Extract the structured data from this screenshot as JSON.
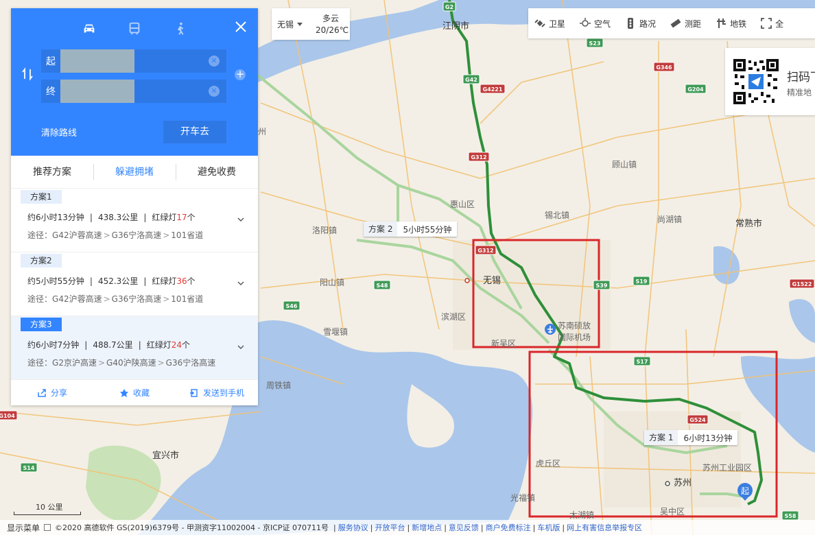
{
  "panel": {
    "modes": [
      {
        "name": "car-icon",
        "active": true
      },
      {
        "name": "bus-icon",
        "active": false
      },
      {
        "name": "walk-icon",
        "active": false
      }
    ],
    "start_label": "起",
    "end_label": "终",
    "clear_route": "清除路线",
    "go_button": "开车去",
    "tabs": [
      "推荐方案",
      "躲避拥堵",
      "避免收费"
    ],
    "active_tab": 1,
    "plans": [
      {
        "tag": "方案1",
        "time": "约6小时13分钟",
        "distance": "438.3公里",
        "lights_prefix": "红绿灯",
        "lights_count": "17",
        "lights_suffix": "个",
        "via_label": "途径：",
        "via": [
          "G42沪蓉高速",
          "G36宁洛高速",
          "101省道"
        ]
      },
      {
        "tag": "方案2",
        "time": "约5小时55分钟",
        "distance": "452.3公里",
        "lights_prefix": "红绿灯",
        "lights_count": "36",
        "lights_suffix": "个",
        "via_label": "途径：",
        "via": [
          "G42沪蓉高速",
          "G36宁洛高速",
          "101省道"
        ]
      },
      {
        "tag": "方案3",
        "time": "约6小时7分钟",
        "distance": "488.7公里",
        "lights_prefix": "红绿灯",
        "lights_count": "24",
        "lights_suffix": "个",
        "via_label": "途径：",
        "via": [
          "G2京沪高速",
          "G40沪陕高速",
          "G36宁洛高速"
        ]
      }
    ],
    "selected_plan": 2,
    "footer": {
      "share": "分享",
      "favorite": "收藏",
      "send_phone": "发送到手机"
    }
  },
  "weather": {
    "city": "无锡",
    "desc": "多云",
    "temp": "20/26℃"
  },
  "toolbar": [
    "卫星",
    "空气",
    "路况",
    "测距",
    "地铁",
    "全"
  ],
  "qr": {
    "title": "扫码下",
    "subtitle": "精准地"
  },
  "callouts": {
    "plan2": {
      "name": "方案 2",
      "time": "5小时55分钟"
    },
    "plan1": {
      "name": "方案 1",
      "time": "6小时13分钟"
    }
  },
  "map": {
    "places": [
      "江阴市",
      "洛阳镇",
      "惠山区",
      "锡北镇",
      "顾山镇",
      "尚湖镇",
      "常熟市",
      "阳山镇",
      "无锡",
      "滨湖区",
      "雪堰镇",
      "苏南硕放",
      "国际机场",
      "新吴区",
      "周铁镇",
      "宜兴市",
      "虎丘区",
      "苏州",
      "苏州工业园区",
      "光福镇",
      "吴中区",
      "太湖镇",
      "州"
    ],
    "start_marker": "起",
    "roads": [
      "G2",
      "G42",
      "G312",
      "G4221",
      "S19",
      "G204",
      "G346",
      "S23",
      "S48",
      "S46",
      "S17",
      "G524",
      "G1522",
      "S58",
      "G104",
      "S14",
      "S39",
      "G312"
    ]
  },
  "scale": "10 公里",
  "bottombar": {
    "show_menu": "显示菜单",
    "copyright": "©2020 高德软件 GS(2019)6379号 - 甲测资字11002004 - 京ICP证 070711号",
    "links": [
      "服务协议",
      "开放平台",
      "新增地点",
      "意见反馈",
      "商户免费标注",
      "车机版",
      "网上有害信息举报专区"
    ]
  }
}
